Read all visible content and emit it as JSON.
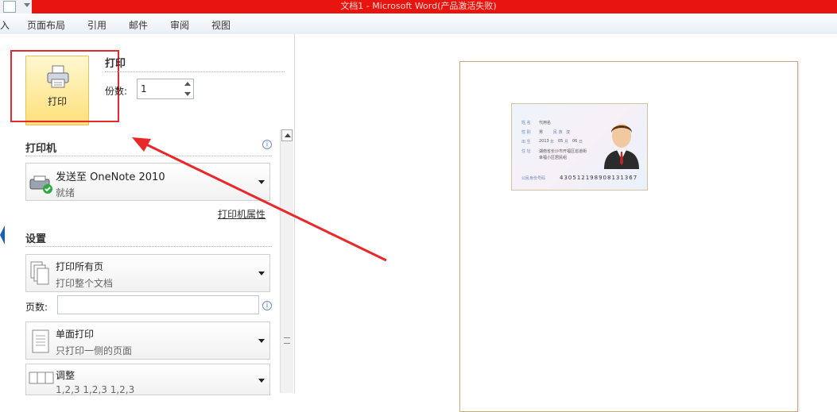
{
  "window": {
    "title": "文档1 - Microsoft Word(产品激活失败)"
  },
  "ribbon_tabs": [
    "入",
    "页面布局",
    "引用",
    "邮件",
    "审阅",
    "视图"
  ],
  "print": {
    "button_label": "打印",
    "section_title": "打印",
    "copies_label": "份数:",
    "copies_value": "1"
  },
  "printer": {
    "section_title": "打印机",
    "name": "发送至 OneNote 2010",
    "status": "就绪",
    "properties_link": "打印机属性"
  },
  "settings": {
    "section_title": "设置",
    "pages_label": "页数:",
    "options": [
      {
        "title": "打印所有页",
        "subtitle": "打印整个文档"
      },
      {
        "title": "单面打印",
        "subtitle": "只打印一侧的页面"
      },
      {
        "title": "调整",
        "subtitle": "1,2,3   1,2,3   1,2,3"
      }
    ]
  },
  "id_card": {
    "name_label": "姓 名",
    "name": "代用名",
    "sex_label": "性 别",
    "sex": "男",
    "ethnicity_label": "民 族",
    "ethnicity": "汉",
    "birth_label": "出 生",
    "birth_year": "2013",
    "birth_month": "05",
    "birth_day": "06",
    "year_label": "年",
    "month_label": "月",
    "day_label": "日",
    "address_label": "住 址",
    "address_1": "湖南省长沙市开福区巡道街",
    "address_2": "幸福小区居民组",
    "id_label": "公民身份号码",
    "id_number": "430512198908131367"
  },
  "colors": {
    "titlebar": "#e8140f",
    "highlight": "#e8282a",
    "print_button": "#ffe07a"
  }
}
